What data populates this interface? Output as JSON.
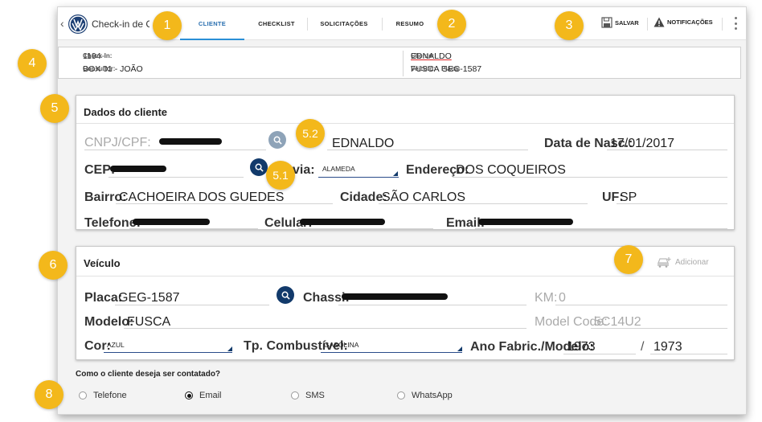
{
  "app": {
    "title": "Check-in de Cliente",
    "title_visible": "Check-in de C"
  },
  "tabs": [
    {
      "label": "CLIENTE",
      "active": true
    },
    {
      "label": "CHECKLIST",
      "active": false
    },
    {
      "label": "SOLICITAÇÕES",
      "active": false
    },
    {
      "label": "RESUMO",
      "active": false
    }
  ],
  "toolbar": {
    "save_label": "SALVAR",
    "notifications_label": "NOTIFICAÇÕES"
  },
  "summary": {
    "checkin_label": "Check-In:",
    "checkin_value": "1194",
    "consultant_label": "Consultor:",
    "consultant_value": "BOX 01 - JOÃO",
    "client_label": "Cliente:",
    "client_value": "EDNALDO",
    "vehicle_label": "Veículo:",
    "vehicle_value": "FUSCA",
    "plate_label": "Placa:",
    "plate_value": "GEG-1587"
  },
  "client_panel": {
    "title": "Dados do cliente",
    "cnpj_label": "CNPJ/CPF:",
    "name_value": "EDNALDO",
    "birth_label": "Data de Nasc.:",
    "birth_value": "17/01/2017",
    "cep_label": "CEP:",
    "street_type_label": "via:",
    "street_type_value": "ALAMEDA",
    "address_label": "Endereço:",
    "address_value": "DOS COQUEIROS",
    "district_label": "Bairro:",
    "district_value": "CACHOEIRA DOS GUEDES",
    "city_label": "Cidade:",
    "city_value": "SÃO CARLOS",
    "state_label": "UF:",
    "state_value": "SP",
    "phone_label": "Telefone:",
    "mobile_label": "Celular:",
    "email_label": "Email:"
  },
  "vehicle_panel": {
    "title": "Veículo",
    "add_label": "Adicionar",
    "plate_label": "Placa:",
    "plate_value": "GEG-1587",
    "chassis_label": "Chassi:",
    "km_label": "KM:",
    "km_value": "0",
    "model_label": "Modelo:",
    "model_value": "FUSCA",
    "model_code_label": "Model Code:",
    "model_code_value": "5C14U2",
    "color_label": "Cor:",
    "color_value": "AZUL",
    "fuel_label": "Tp. Combustível:",
    "fuel_value": "GASOLINA",
    "year_label": "Ano Fabric./Modelo:",
    "year_fab": "1973",
    "year_sep": "/",
    "year_model": "1973"
  },
  "contact": {
    "question": "Como o cliente deseja ser contatado?",
    "options": [
      {
        "label": "Telefone",
        "selected": false
      },
      {
        "label": "Email",
        "selected": true
      },
      {
        "label": "SMS",
        "selected": false
      },
      {
        "label": "WhatsApp",
        "selected": false
      }
    ]
  },
  "callouts": [
    "1",
    "2",
    "3",
    "4",
    "5",
    "5.1",
    "5.2",
    "6",
    "7",
    "8"
  ],
  "colors": {
    "accent": "#2a8fd6",
    "callout": "#f3b81b",
    "navy": "#123a6b"
  }
}
